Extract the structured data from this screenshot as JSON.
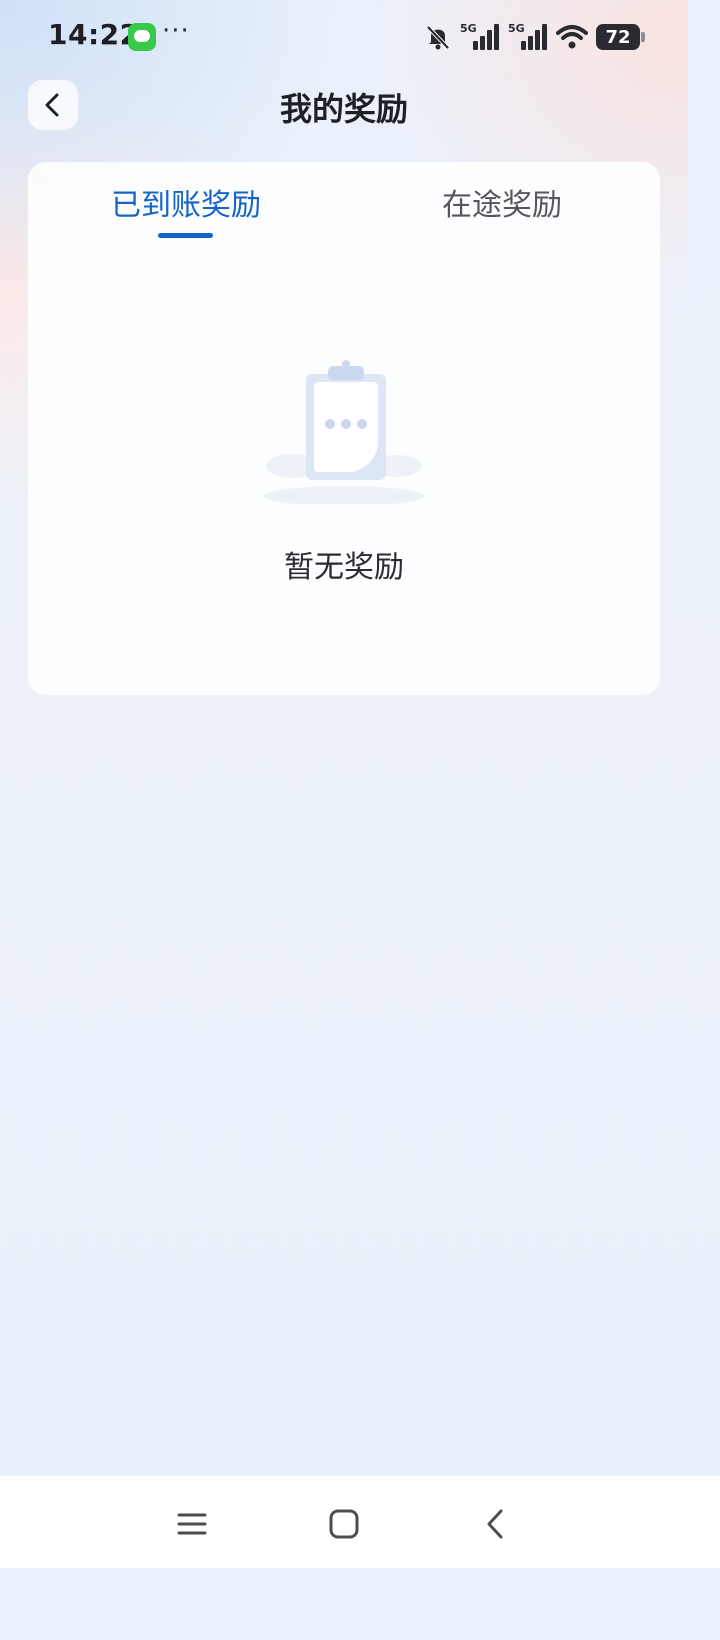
{
  "status_bar": {
    "time": "14:22",
    "more": "···",
    "network_1": "5G",
    "network_2": "5G",
    "battery": "72"
  },
  "header": {
    "title": "我的奖励"
  },
  "tabs": [
    {
      "label": "已到账奖励",
      "active": true
    },
    {
      "label": "在途奖励",
      "active": false
    }
  ],
  "empty_state": {
    "text": "暂无奖励"
  },
  "colors": {
    "accent": "#1565c8",
    "message_app": "#36c94a"
  },
  "icons": {
    "back": "back-arrow-icon",
    "empty": "clipboard-icon",
    "nav_menu": "menu-icon",
    "nav_home": "home-icon",
    "nav_back": "back-icon"
  }
}
